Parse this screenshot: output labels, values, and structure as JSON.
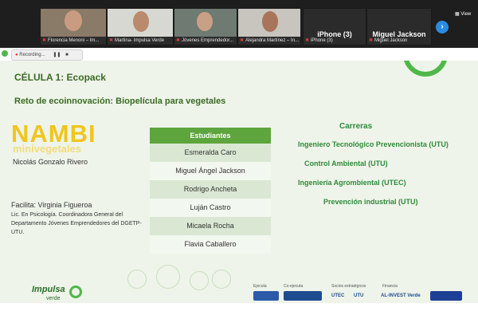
{
  "participants": [
    {
      "name": "Florencia Menoni – Im...",
      "muted": true
    },
    {
      "name": "Martina- Impulsa Verde",
      "muted": true
    },
    {
      "name": "Jóvenes Emprendedor...",
      "muted": true
    },
    {
      "name": "Alejandra Martínez – In...",
      "muted": true
    },
    {
      "name": "iPhone (3)",
      "muted": true,
      "display": "iPhone (3)"
    },
    {
      "name": "Miguel Jackson",
      "muted": true,
      "display": "Miguel Jackson"
    }
  ],
  "view_label": "View",
  "recording_label": "Recording...",
  "slide": {
    "celula": "CÉLULA 1: Ecopack",
    "reto": "Reto de ecoinnovación: Biopelícula para vegetales",
    "brand_main": "NAMBI",
    "brand_sub": "minivegetales",
    "person": "Nicolás Gonzalo Rivero",
    "facilita": "Facilita: Virginia Figueroa",
    "facilita_desc": "Lic. En Psicología. Coordinadora General del Departamento Jóvenes Emprendedores del DGETP-UTU.",
    "table_header": "Estudiantes",
    "students": [
      "Esmeralda Caro",
      "Miguel Ángel Jackson",
      "Rodrigo Ancheta",
      "Luján Castro",
      "Micaela Rocha",
      "Flavia Caballero"
    ],
    "carreras_header": "Carreras",
    "carreras": [
      "Ingeniero Tecnológico  Prevencionista (UTU)",
      "Control Ambiental (UTU)",
      "Ingeniería Agrombiental (UTEC)",
      "Prevención industrial (UTU)"
    ],
    "footer_logo_main": "Impulsa",
    "footer_logo_sub": "verde",
    "sponsor_labels": [
      "Ejecuta",
      "Co-ejecuta",
      "Socios estratégicos",
      "Financia"
    ],
    "sponsor_names": [
      "UTEC",
      "UTU",
      "AL-INVEST Verde"
    ]
  },
  "colors": {
    "accent_green": "#4fb848",
    "title_green": "#3a6a24",
    "brand_yellow": "#f0c51e"
  }
}
